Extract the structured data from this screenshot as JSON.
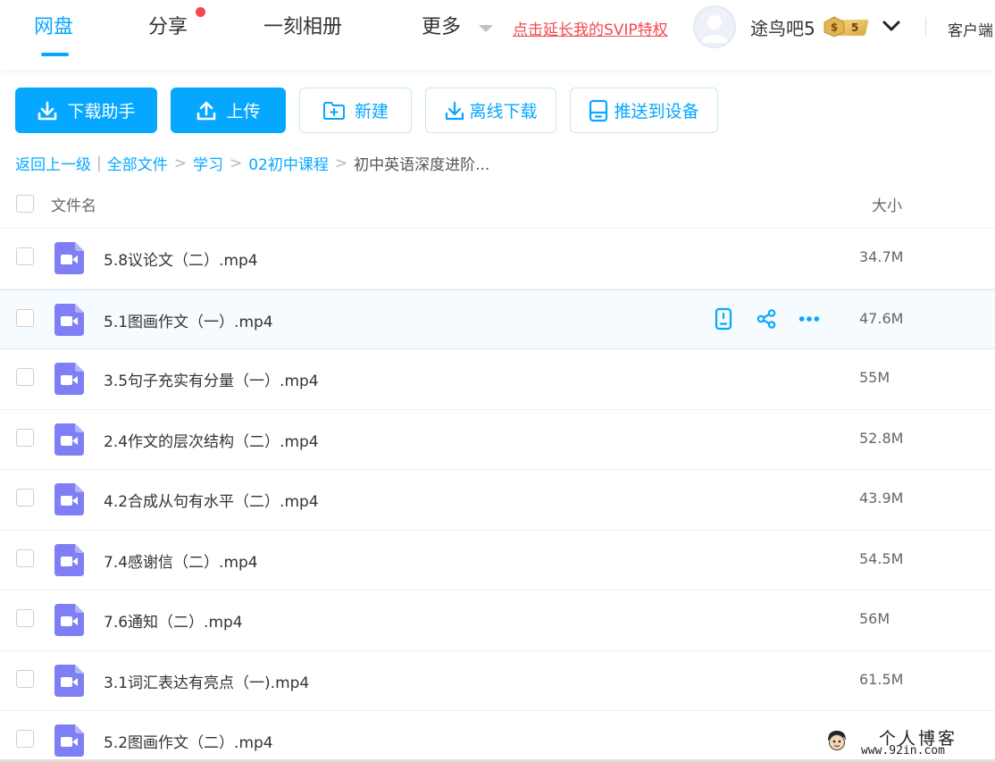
{
  "nav": {
    "tabs": [
      {
        "label": "网盘",
        "active": true
      },
      {
        "label": "分享",
        "has_dot": true
      },
      {
        "label": "一刻相册"
      },
      {
        "label": "更多"
      }
    ],
    "svip_link": "点击延长我的SVIP特权",
    "username": "途鸟吧5",
    "vip_level": "5",
    "client_link": "客户端"
  },
  "toolbar": {
    "download_helper": "下载助手",
    "upload": "上传",
    "new": "新建",
    "offline_download": "离线下载",
    "push_to_device": "推送到设备"
  },
  "breadcrumb": {
    "back": "返回上一级",
    "items": [
      "全部文件",
      "学习",
      "02初中课程"
    ],
    "current": "初中英语深度进阶..."
  },
  "list": {
    "header": {
      "name": "文件名",
      "size": "大小"
    },
    "rows": [
      {
        "name": "5.8议论文（二）.mp4",
        "size": "34.7M"
      },
      {
        "name": "5.1图画作文（一）.mp4",
        "size": "47.6M"
      },
      {
        "name": "3.5句子充实有分量（一）.mp4",
        "size": "55M"
      },
      {
        "name": "2.4作文的层次结构（二）.mp4",
        "size": "52.8M"
      },
      {
        "name": "4.2合成从句有水平（二）.mp4",
        "size": "43.9M"
      },
      {
        "name": "7.4感谢信（二）.mp4",
        "size": "54.5M"
      },
      {
        "name": "7.6通知（二）.mp4",
        "size": "56M"
      },
      {
        "name": "3.1词汇表达有亮点（一).mp4",
        "size": "61.5M"
      },
      {
        "name": "5.2图画作文（二）.mp4",
        "size": ""
      }
    ]
  },
  "watermark": {
    "title": "个人博客",
    "url": "www.92in.com"
  },
  "colors": {
    "accent": "#06a7ff",
    "red": "#f4474d",
    "video_icon": "#7f7ff5"
  }
}
